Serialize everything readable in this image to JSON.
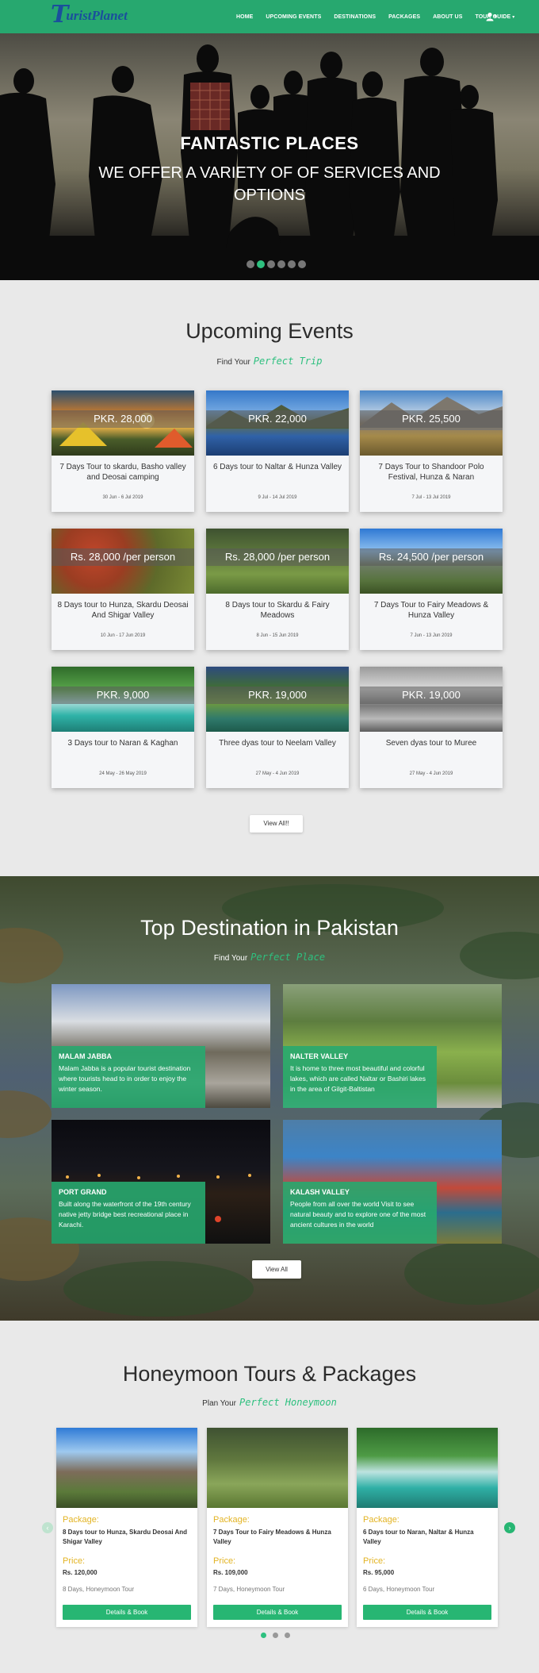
{
  "nav": {
    "logo_letter": "T",
    "logo_text": "uristPlanet",
    "items": [
      "HOME",
      "UPCOMING EVENTS",
      "DESTINATIONS",
      "PACKAGES",
      "ABOUT US",
      "TOUR GUIDE"
    ],
    "accent": "#27a86f"
  },
  "hero": {
    "title": "FANTASTIC PLACES",
    "subtitle": "WE OFFER A VARIETY OF OF SERVICES AND OPTIONS",
    "slide_count": 6,
    "active_slide": 2
  },
  "events": {
    "title": "Upcoming Events",
    "sub_prefix": "Find Your",
    "sub_highlight": "Perfect Trip",
    "cards": [
      {
        "price": "PKR. 28,000",
        "title": "7 Days Tour to skardu, Basho valley and Deosai camping",
        "date": "30 Jun - 6 Jul 2019"
      },
      {
        "price": "PKR. 22,000",
        "title": "6 Days tour to Naltar & Hunza Valley",
        "date": "9 Jul - 14 Jul 2019"
      },
      {
        "price": "PKR. 25,500",
        "title": "7 Days Tour to Shandoor Polo Festival, Hunza & Naran",
        "date": "7 Jul - 13 Jul 2019"
      },
      {
        "price": "Rs. 28,000 /per person",
        "title": "8 Days tour to Hunza, Skardu Deosai And Shigar Valley",
        "date": "10 Jun - 17 Jun 2019"
      },
      {
        "price": "Rs. 28,000 /per person",
        "title": "8 Days tour to Skardu & Fairy Meadows",
        "date": "8 Jun - 15 Jun 2019"
      },
      {
        "price": "Rs. 24,500 /per person",
        "title": "7 Days Tour to Fairy Meadows & Hunza Valley",
        "date": "7 Jun - 13 Jun 2019"
      },
      {
        "price": "PKR. 9,000",
        "title": "3 Days tour to Naran & Kaghan",
        "date": "24 May - 26 May 2019"
      },
      {
        "price": "PKR. 19,000",
        "title": "Three dyas tour to Neelam Valley",
        "date": "27 May - 4 Jun 2019"
      },
      {
        "price": "PKR. 19,000",
        "title": "Seven dyas tour to Muree",
        "date": "27 May - 4 Jun 2019"
      }
    ],
    "view_all": "View All!!"
  },
  "destinations": {
    "title": "Top Destination in Pakistan",
    "sub_prefix": "Find Your",
    "sub_highlight": "Perfect Place",
    "cards": [
      {
        "name": "MALAM JABBA",
        "desc": "Malam Jabba is a popular tourist destination where tourists head to in order to enjoy the winter season."
      },
      {
        "name": "NALTER VALLEY",
        "desc": "It is home to three most beautiful and colorful lakes, which are called Naltar or Bashiri lakes in the area of Gilgit-Baltistan"
      },
      {
        "name": "PORT GRAND",
        "desc": "Built along the waterfront of the 19th century native jetty bridge best recreational place in Karachi."
      },
      {
        "name": "KALASH VALLEY",
        "desc": "People from all over the world Visit to see natural beauty and to explore one of the most ancient cultures in the world"
      }
    ],
    "view_all": "View All"
  },
  "honeymoon": {
    "title": "Honeymoon Tours & Packages",
    "sub_prefix": "Plan Your",
    "sub_highlight": "Perfect Honeymoon",
    "package_label": "Package:",
    "price_label": "Price:",
    "cards": [
      {
        "package": "8 Days tour to Hunza, Skardu Deosai And Shigar Valley",
        "price": "Rs. 120,000",
        "meta": "8 Days, Honeymoon Tour",
        "button": "Details & Book"
      },
      {
        "package": "7 Days Tour to Fairy Meadows & Hunza Valley",
        "price": "Rs. 109,000",
        "meta": "7 Days, Honeymoon Tour",
        "button": "Details & Book"
      },
      {
        "package": "6 Days tour to Naran, Naltar & Hunza Valley",
        "price": "Rs. 95,000",
        "meta": "6 Days, Honeymoon Tour",
        "button": "Details & Book"
      }
    ],
    "prev_icon": "chevron-left-icon",
    "next_icon": "chevron-right-icon"
  }
}
